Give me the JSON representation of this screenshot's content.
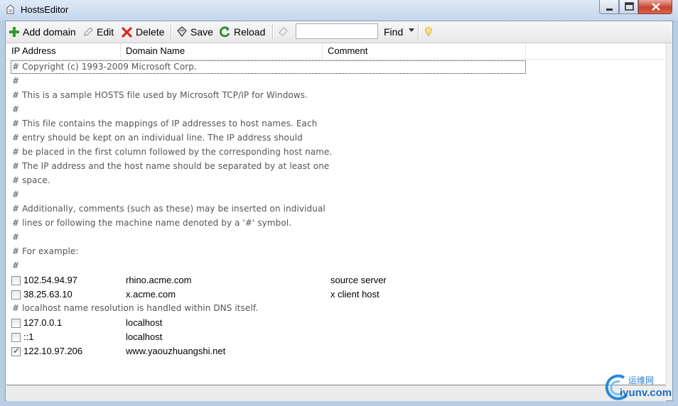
{
  "window": {
    "title": "HostsEditor"
  },
  "toolbar": {
    "add_label": "Add domain",
    "edit_label": "Edit",
    "delete_label": "Delete",
    "save_label": "Save",
    "reload_label": "Reload",
    "find_value": "",
    "find_label": "Find"
  },
  "columns": {
    "ip": "IP Address",
    "domain": "Domain Name",
    "comment": "Comment"
  },
  "comments": [
    "# Copyright (c) 1993-2009 Microsoft Corp.",
    "#",
    "# This is a sample HOSTS file used by Microsoft TCP/IP for Windows.",
    "#",
    "# This file contains the mappings of IP addresses to host names. Each",
    "# entry should be kept on an individual line. The IP address should",
    "# be placed in the first column followed by the corresponding host name.",
    "# The IP address and the host name should be separated by at least one",
    "# space.",
    "#",
    "# Additionally, comments (such as these) may be inserted on individual",
    "# lines or following the machine name denoted by a '#' symbol.",
    "#",
    "# For example:",
    "#",
    "# localhost name resolution is handled within DNS itself."
  ],
  "entries": [
    {
      "ip": "102.54.94.97",
      "domain": "rhino.acme.com",
      "comment": "source server",
      "enabled": false
    },
    {
      "ip": "38.25.63.10",
      "domain": "x.acme.com",
      "comment": "x client host",
      "enabled": false
    },
    {
      "ip": "127.0.0.1",
      "domain": "localhost",
      "comment": "",
      "enabled": false
    },
    {
      "ip": "::1",
      "domain": "localhost",
      "comment": "",
      "enabled": false
    },
    {
      "ip": "122.10.97.206",
      "domain": "www.yaouzhuangshi.net",
      "comment": "",
      "enabled": true
    }
  ],
  "watermark": {
    "top": "运维网",
    "bottom": "iyunv.com"
  },
  "colors": {
    "add_icon": "#2f9a2f",
    "delete_icon": "#d62a1d",
    "reload_icon": "#2f8f2f",
    "bulb_icon": "#f4d35e"
  }
}
